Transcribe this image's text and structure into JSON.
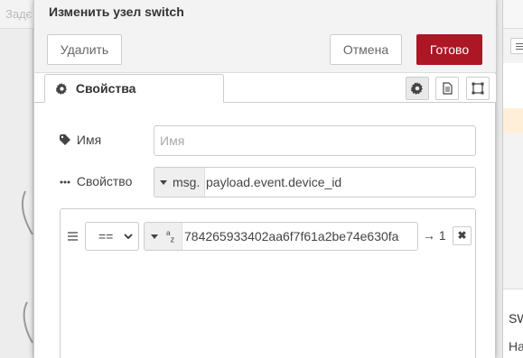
{
  "workspace": {
    "tab_label": "Задє"
  },
  "sidebar": {
    "info_title": "SW",
    "info_text": "На",
    "highlight_color": "#ffefd8"
  },
  "editor": {
    "title": "Изменить узел switch",
    "delete_label": "Удалить",
    "cancel_label": "Отмена",
    "done_label": "Готово",
    "done_color": "#ad1625",
    "tabs": [
      {
        "label": "Свойства",
        "icon": "gear-icon",
        "active": true
      }
    ],
    "icon_tabs": [
      "gear-icon",
      "document-icon",
      "frame-icon"
    ],
    "name": {
      "label": "Имя",
      "icon": "tag-icon",
      "placeholder": "Имя",
      "value": ""
    },
    "property": {
      "label": "Свойство",
      "icon": "ellipsis-icon",
      "type": "msg.",
      "value": "payload.event.device_id"
    },
    "rules": [
      {
        "operator": "==",
        "value_type": "az",
        "value": "784265933402aa6f7f61a2be74e630fa",
        "output": "→ 1",
        "remove_label": "✖"
      }
    ]
  }
}
